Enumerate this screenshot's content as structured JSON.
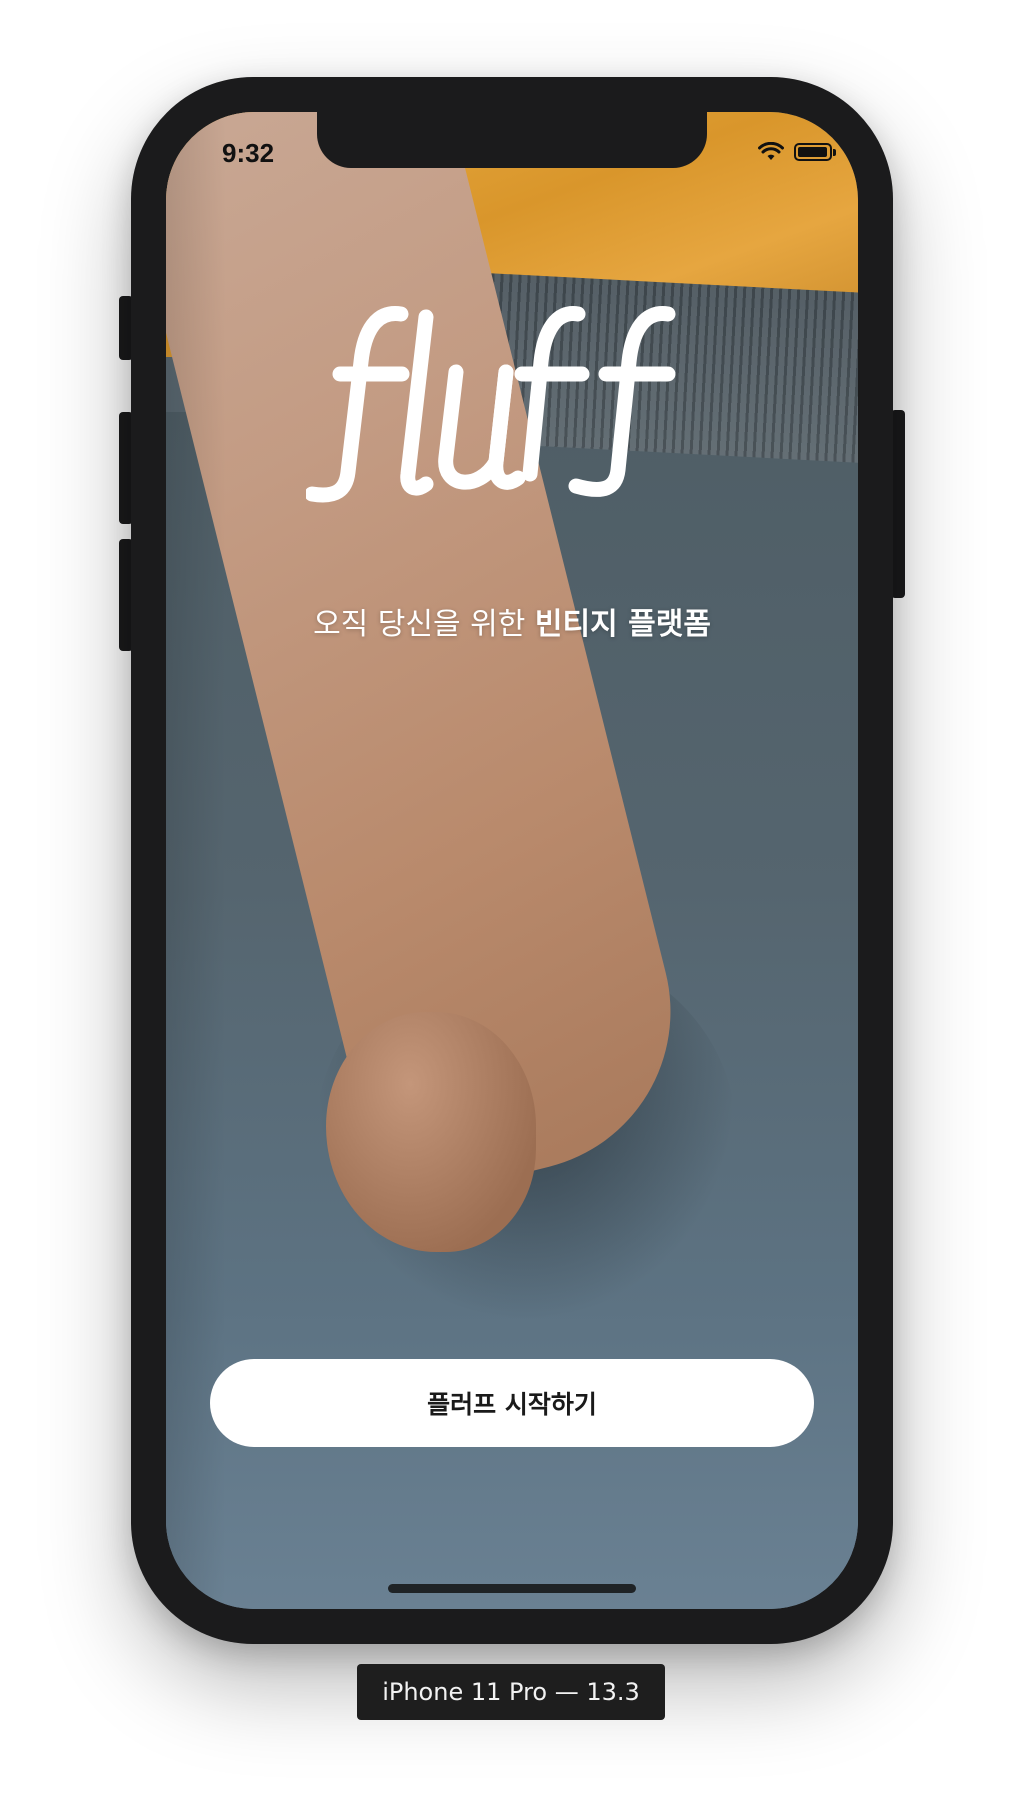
{
  "status_bar": {
    "time": "9:32",
    "icons": [
      "wifi-icon",
      "battery-icon"
    ]
  },
  "app": {
    "logo_text": "fluff",
    "tagline": {
      "regular": "오직 당신을 위한 ",
      "bold": "빈티지 플랫폼"
    },
    "start_button_label": "플러프 시작하기"
  },
  "device": {
    "label": "iPhone 11 Pro — 13.3"
  },
  "colors": {
    "phone_frame": "#1b1b1c",
    "button_bg": "#ffffff",
    "button_text": "#1a1a1a",
    "tagline_text": "#ffffff",
    "shirt": "#e2a03a",
    "pants": "#5a6b76"
  }
}
